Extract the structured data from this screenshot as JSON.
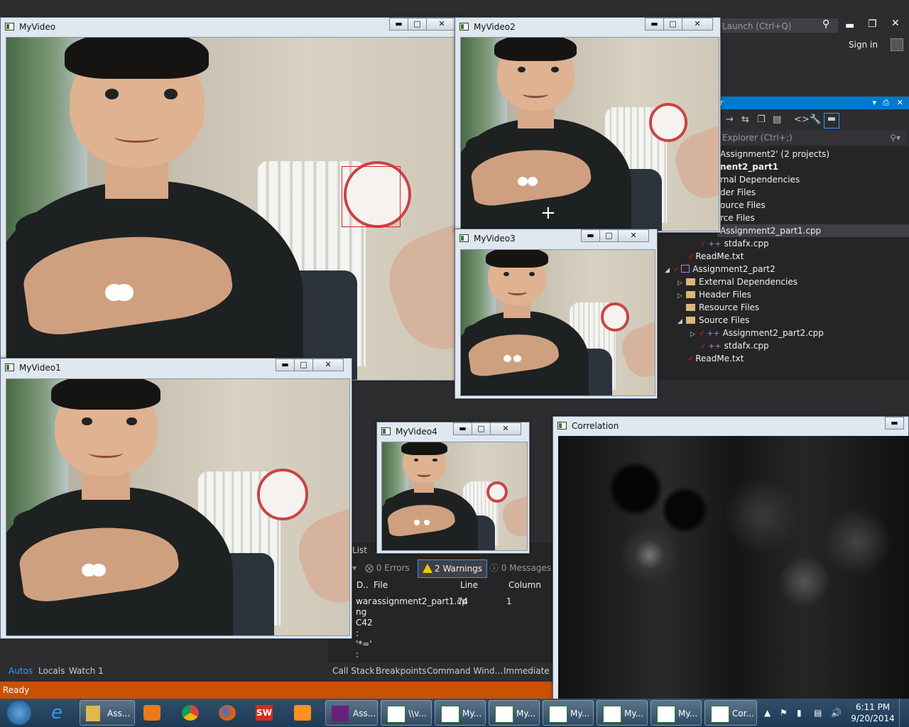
{
  "vs": {
    "quick_launch": "Launch (Ctrl+Q)",
    "sign_in": "Sign in",
    "se_search": "Explorer (Ctrl+;)",
    "se_header": "r",
    "tree": [
      {
        "text": "Assignment2' (2 projects)"
      },
      {
        "text": "nent2_part1"
      },
      {
        "text": "rnal Dependencies"
      },
      {
        "text": "der Files"
      },
      {
        "text": "ource Files"
      },
      {
        "text": "rce Files"
      },
      {
        "text": "Assignment2_part1.cpp"
      },
      {
        "text": "stdafx.cpp"
      },
      {
        "text": "ReadMe.txt"
      },
      {
        "text": "Assignment2_part2"
      },
      {
        "text": "External Dependencies"
      },
      {
        "text": "Header Files"
      },
      {
        "text": "Resource Files"
      },
      {
        "text": "Source Files"
      },
      {
        "text": "Assignment2_part2.cpp"
      },
      {
        "text": "stdafx.cpp"
      },
      {
        "text": "ReadMe.txt"
      }
    ],
    "error_list": {
      "title": "List",
      "errors": "0 Errors",
      "warnings": "2 Warnings",
      "messages": "0 Messages",
      "columns": [
        "D..",
        "File",
        "Line",
        "Column"
      ],
      "row": {
        "desc": [
          "war",
          "ng",
          "C42",
          ":",
          "'*='",
          ":"
        ],
        "file": "assignment2_part1.cp",
        "line": "74",
        "column": "1"
      }
    },
    "bottom_tabs_left": [
      "Autos",
      "Locals",
      "Watch 1"
    ],
    "bottom_tabs_right": [
      "Call Stack",
      "Breakpoints",
      "Command Wind...",
      "Immediate W"
    ],
    "status": "Ready"
  },
  "windows": {
    "video": "MyVideo",
    "video1": "MyVideo1",
    "video2": "MyVideo2",
    "video3": "MyVideo3",
    "video4": "MyVideo4",
    "correlation": "Correlation"
  },
  "taskbar": {
    "items": [
      "Ass...",
      "\\\\v...",
      "My...",
      "My...",
      "My...",
      "My...",
      "My...",
      "Cor..."
    ],
    "ass2": "Ass...",
    "time": "6:11 PM",
    "date": "9/20/2014"
  },
  "colors": {
    "vs_accent": "#007acc",
    "status_bar": "#ca5100",
    "detect_box": "#e02020"
  }
}
